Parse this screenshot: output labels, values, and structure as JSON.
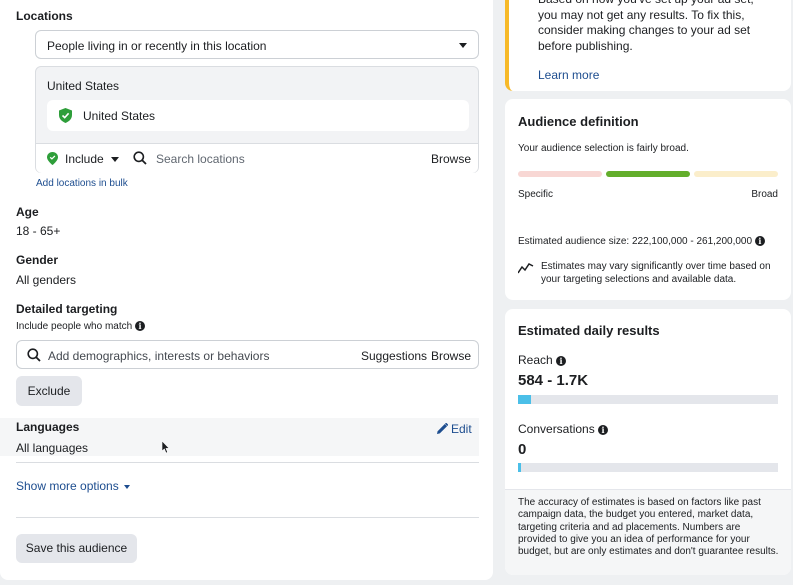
{
  "locations": {
    "label": "Locations",
    "mode_value": "People living in or recently in this location",
    "country_label": "United States",
    "chip_label": "United States",
    "include_label": "Include",
    "search_placeholder": "Search locations",
    "browse_label": "Browse",
    "bulk_link": "Add locations in bulk"
  },
  "age": {
    "label": "Age",
    "value": "18 - 65+"
  },
  "gender": {
    "label": "Gender",
    "value": "All genders"
  },
  "detailed_targeting": {
    "label": "Detailed targeting",
    "sublabel": "Include people who match",
    "placeholder": "Add demographics, interests or behaviors",
    "suggestions_label": "Suggestions",
    "browse_label": "Browse",
    "exclude_label": "Exclude"
  },
  "languages": {
    "label": "Languages",
    "value": "All languages",
    "edit_label": "Edit"
  },
  "show_more": "Show more options",
  "save_audience": "Save this audience",
  "warning": {
    "text": "Based on how you've set up your ad set, you may not get any results. To fix this, consider making changes to your ad set before publishing.",
    "link": "Learn more",
    "accent_color": "#f7b928"
  },
  "audience_definition": {
    "title": "Audience definition",
    "subtitle": "Your audience selection is fairly broad.",
    "specific_label": "Specific",
    "broad_label": "Broad",
    "gauge_active_color": "#63ae2b",
    "size_text": "Estimated audience size: 222,100,000 - 261,200,000",
    "note": "Estimates may vary significantly over time based on your targeting selections and available data."
  },
  "daily_results": {
    "title": "Estimated daily results",
    "reach_label": "Reach",
    "reach_value": "584 - 1.7K",
    "reach_fill": 0.05,
    "conversations_label": "Conversations",
    "conversations_value": "0",
    "conversations_fill": 0.01,
    "disclaimer": "The accuracy of estimates is based on factors like past campaign data, the budget you entered, market data, targeting criteria and ad placements. Numbers are provided to give you an idea of performance for your budget, but are only estimates and don't guarantee results."
  },
  "colors": {
    "link": "#1d4d8f",
    "accent_blue": "#4bbfe8",
    "green_pin": "#2e9e3a"
  }
}
